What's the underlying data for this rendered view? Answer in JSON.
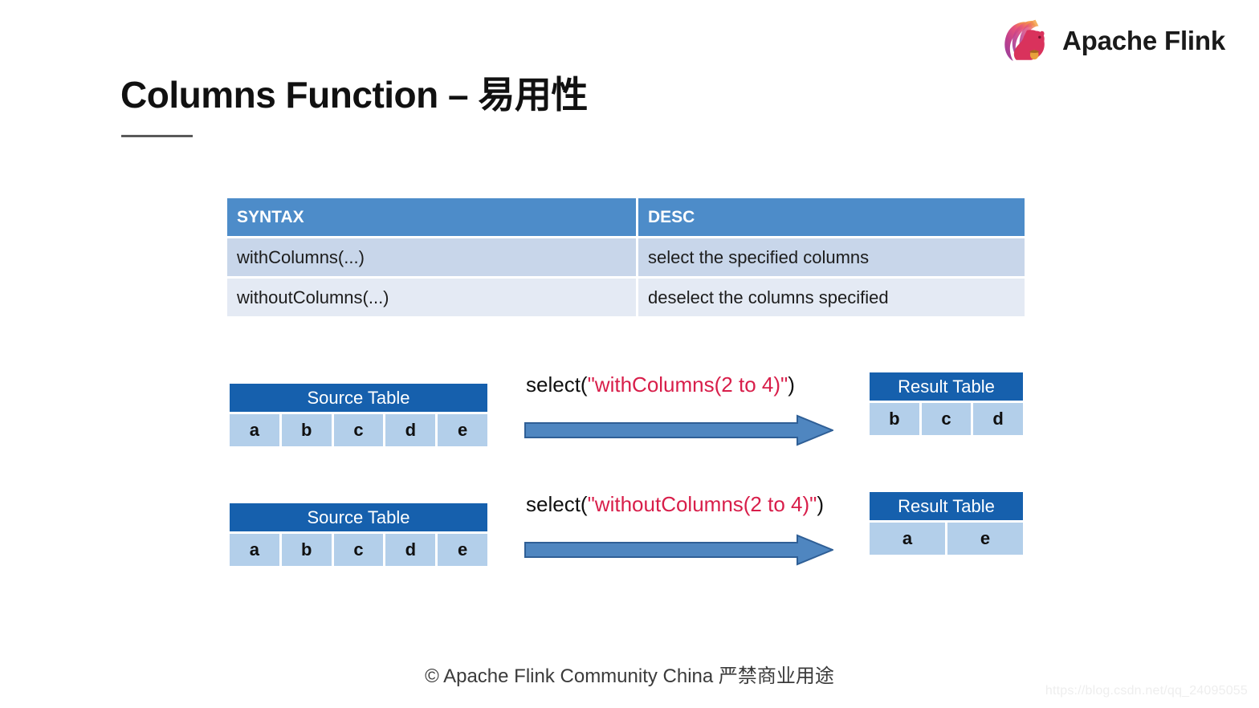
{
  "brand": {
    "name": "Apache Flink",
    "logo_icon": "flink-squirrel-logo"
  },
  "title": {
    "text": "Columns Function – 易用性"
  },
  "syntax_table": {
    "headers": [
      "SYNTAX",
      "DESC"
    ],
    "rows": [
      {
        "syntax": "withColumns(...)",
        "desc": "select the specified columns"
      },
      {
        "syntax": "withoutColumns(...)",
        "desc": "deselect the columns specified"
      }
    ]
  },
  "flows": [
    {
      "source": {
        "title": "Source Table",
        "columns": [
          "a",
          "b",
          "c",
          "d",
          "e"
        ]
      },
      "expression": {
        "prefix": "select(",
        "code": "\"withColumns(2 to 4)\"",
        "suffix": ")"
      },
      "arrow_icon": "right-block-arrow",
      "result": {
        "title": "Result Table",
        "columns": [
          "b",
          "c",
          "d"
        ]
      }
    },
    {
      "source": {
        "title": "Source Table",
        "columns": [
          "a",
          "b",
          "c",
          "d",
          "e"
        ]
      },
      "expression": {
        "prefix": "select(",
        "code": "\"withoutColumns(2 to 4)\"",
        "suffix": ")"
      },
      "arrow_icon": "right-block-arrow",
      "result": {
        "title": "Result Table",
        "columns": [
          "a",
          "e"
        ]
      }
    }
  ],
  "footer": {
    "text": "© Apache Flink Community China  严禁商业用途"
  },
  "watermark": {
    "text": "https://blog.csdn.net/qq_24095055"
  },
  "colors": {
    "table_header_blue": "#4d8cc9",
    "row_odd": "#c8d6ea",
    "row_even": "#e4eaf4",
    "diagram_header_blue": "#1660ad",
    "diagram_cell_blue": "#b3cfea",
    "arrow_fill": "#4f86c0",
    "arrow_stroke": "#2f5f96",
    "code_red": "#d81e4a"
  }
}
